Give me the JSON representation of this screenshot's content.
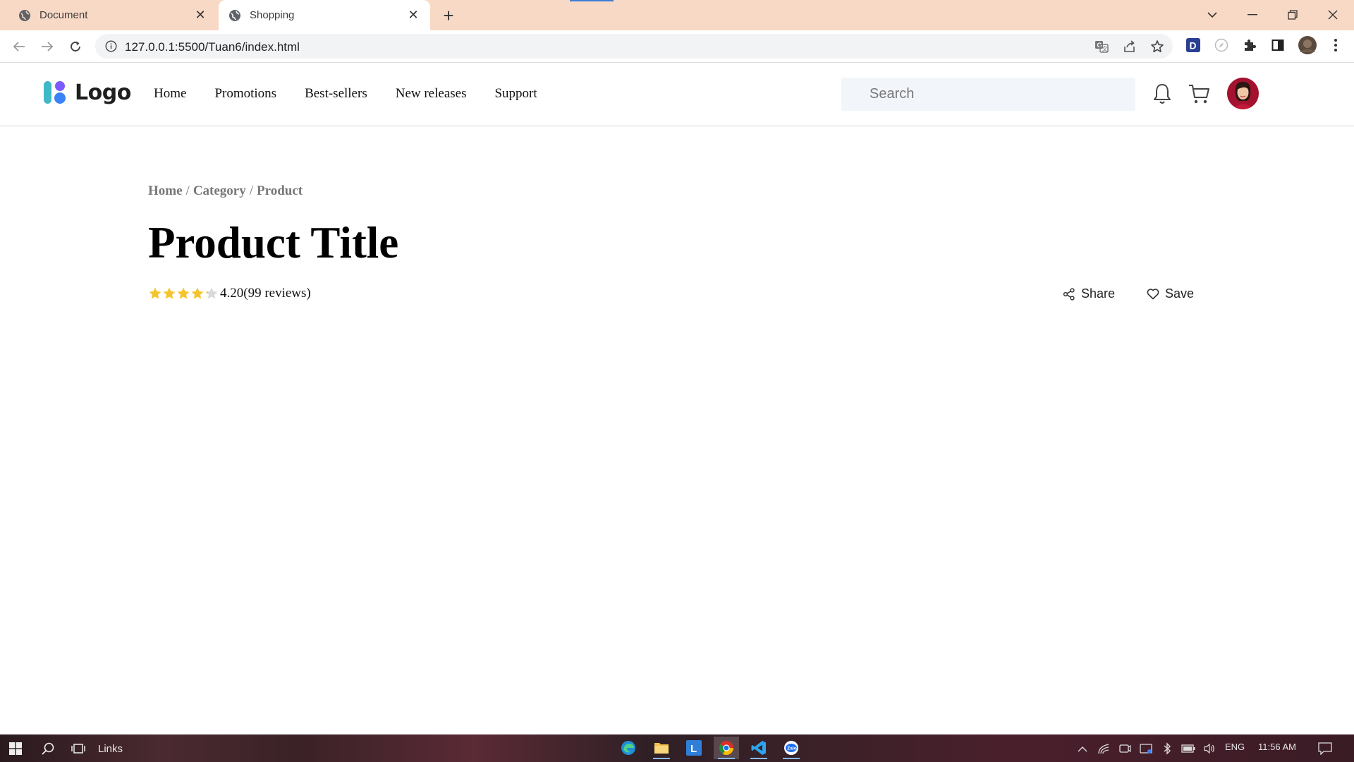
{
  "browser": {
    "tabs": [
      {
        "title": "Document",
        "active": false
      },
      {
        "title": "Shopping",
        "active": true
      }
    ],
    "url": "127.0.0.1:5500/Tuan6/index.html"
  },
  "header": {
    "logo_text": "Logo",
    "nav": [
      "Home",
      "Promotions",
      "Best-sellers",
      "New releases",
      "Support"
    ],
    "search_placeholder": "Search"
  },
  "product": {
    "breadcrumb": [
      "Home",
      "Category",
      "Product"
    ],
    "title": "Product Title",
    "rating": 4.2,
    "rating_text": "4.20(99 reviews)",
    "actions": {
      "share": "Share",
      "save": "Save"
    }
  },
  "taskbar": {
    "search_label": "Links",
    "language": "ENG",
    "time": "11:56 AM"
  },
  "colors": {
    "tabstrip": "#f8d9c6",
    "star": "#f5c32c",
    "logo_blue": "#3b82f6",
    "logo_purple": "#7c5cff"
  }
}
